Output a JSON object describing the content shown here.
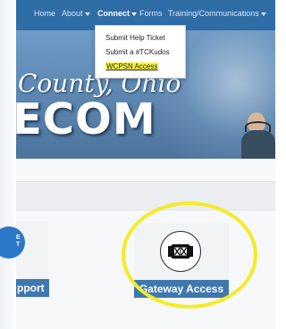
{
  "nav": {
    "items": [
      {
        "label": "Home",
        "has_caret": false,
        "active": false
      },
      {
        "label": "About",
        "has_caret": true,
        "active": false
      },
      {
        "label": "Connect",
        "has_caret": true,
        "active": true
      },
      {
        "label": "Forms",
        "has_caret": false,
        "active": false
      },
      {
        "label": "Training/Communications",
        "has_caret": true,
        "active": false
      }
    ]
  },
  "dropdown": {
    "items": [
      {
        "label": "Submit Help Ticket",
        "highlighted": false
      },
      {
        "label": "Submit a #TCKudos",
        "highlighted": false
      },
      {
        "label": "WCPSN Access",
        "highlighted": true
      }
    ]
  },
  "hero": {
    "county_text": "County, Ohio",
    "ecom_text": "ECOM"
  },
  "tiles": [
    {
      "caption": "pport",
      "icon": "badge-icon",
      "partially_visible": true
    },
    {
      "caption": "Gateway Access",
      "icon": "gateway-icon",
      "partially_visible": false
    }
  ],
  "colors": {
    "navbar": "#2f6da6",
    "caption_bg": "#3f77af",
    "highlight": "#f6f43c",
    "annotation": "#f3ec28",
    "tile_left_icon": "#2b77c9"
  }
}
